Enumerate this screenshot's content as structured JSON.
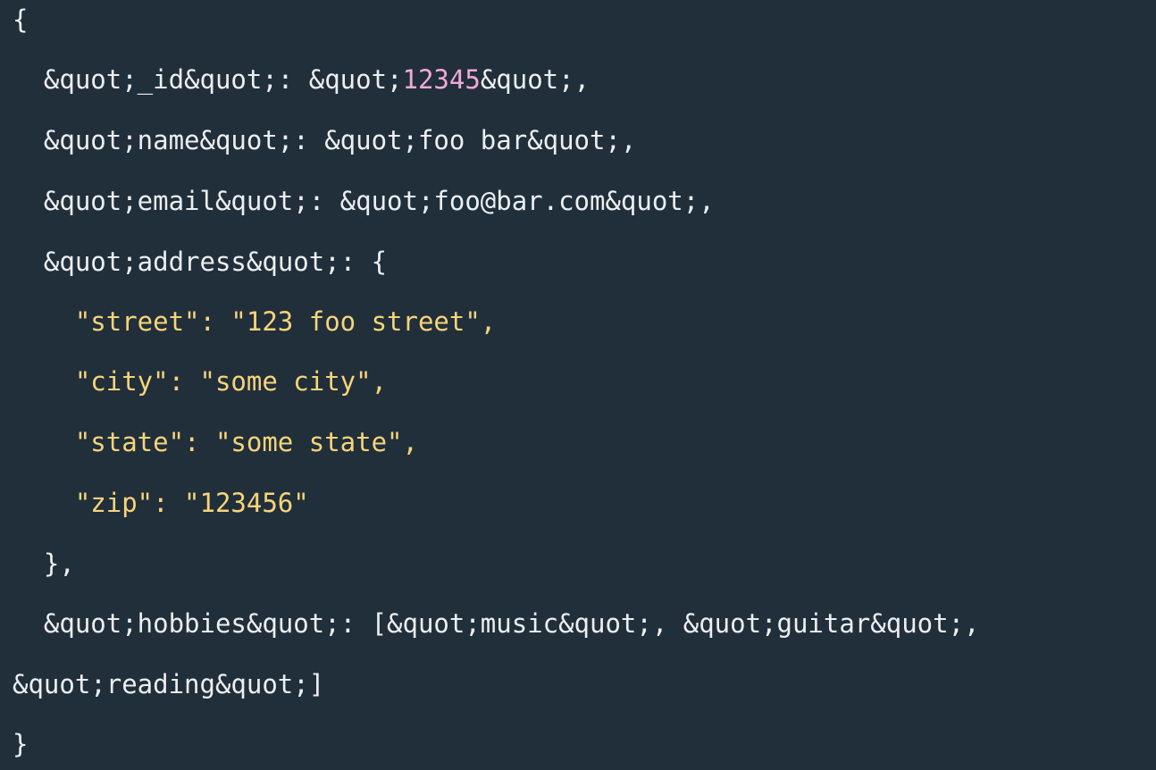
{
  "colors": {
    "background": "#212f3b",
    "plain_text": "#eceff1",
    "number_highlight": "#f2a8d8",
    "string_highlight": "#f6d47a"
  },
  "code": {
    "line1": "{",
    "line2_pre": "  &quot;_id&quot;: &quot;",
    "line2_num": "12345",
    "line2_post": "&quot;,",
    "line3": "  &quot;name&quot;: &quot;foo bar&quot;,",
    "line4": "  &quot;email&quot;: &quot;foo@bar.com&quot;,",
    "line5": "  &quot;address&quot;: {",
    "line6": "    \"street\": \"123 foo street\",",
    "line7": "    \"city\": \"some city\",",
    "line8": "    \"state\": \"some state\",",
    "line9": "    \"zip\": \"123456\"",
    "line10": "  },",
    "line11": "  &quot;hobbies&quot;: [&quot;music&quot;, &quot;guitar&quot;,",
    "line12": "&quot;reading&quot;]",
    "line13": "}"
  }
}
